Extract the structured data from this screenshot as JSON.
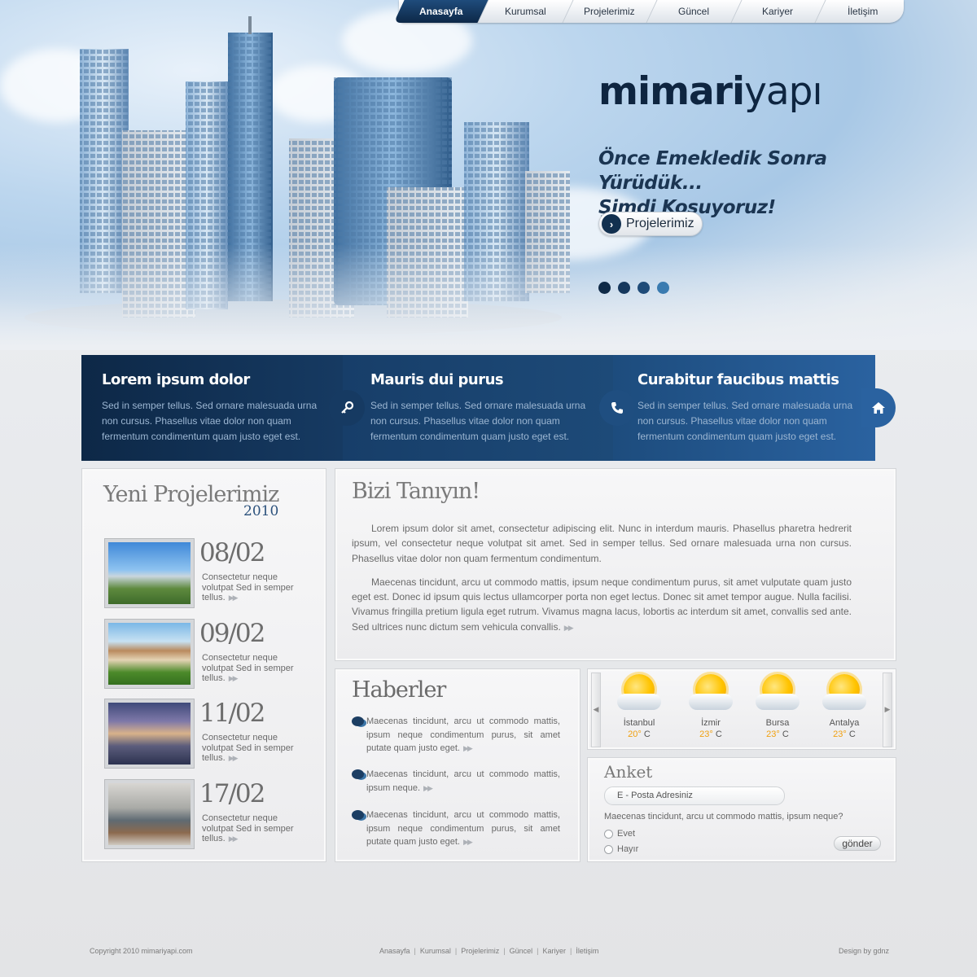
{
  "nav": {
    "items": [
      {
        "label": "Anasayfa",
        "active": true
      },
      {
        "label": "Kurumsal"
      },
      {
        "label": "Projelerimiz"
      },
      {
        "label": "Güncel"
      },
      {
        "label": "Kariyer"
      },
      {
        "label": "İletişim"
      }
    ]
  },
  "hero": {
    "logo_bold": "mimari",
    "logo_light": "yapı",
    "tagline_line1": "Önce Emekledik Sonra Yürüdük...",
    "tagline_line2": "Şimdi Koşuyoruz!",
    "button_label": "Projelerimiz",
    "slide_count": 4
  },
  "features": [
    {
      "title": "Lorem ipsum dolor",
      "text": "Sed in semper tellus. Sed ornare malesuada urna non cursus. Phasellus vitae dolor non quam fermentum condimentum quam justo eget est.",
      "icon": "key-icon"
    },
    {
      "title": "Mauris dui purus",
      "text": "Sed in semper tellus. Sed ornare malesuada urna non cursus. Phasellus vitae dolor non quam fermentum condimentum quam justo eget est.",
      "icon": "phone-icon"
    },
    {
      "title": "Curabitur faucibus mattis",
      "text": "Sed in semper tellus. Sed ornare malesuada urna non cursus. Phasellus vitae dolor non quam fermentum condimentum quam justo eget est.",
      "icon": "home-icon"
    }
  ],
  "projects": {
    "title": "Yeni Projelerimiz",
    "year": "2010",
    "items": [
      {
        "date": "08/02",
        "text": "Consectetur neque volutpat Sed in semper tellus."
      },
      {
        "date": "09/02",
        "text": "Consectetur neque volutpat Sed in semper tellus."
      },
      {
        "date": "11/02",
        "text": "Consectetur neque volutpat Sed in semper tellus."
      },
      {
        "date": "17/02",
        "text": "Consectetur neque volutpat Sed in semper tellus."
      }
    ]
  },
  "about": {
    "title": "Bizi Tanıyın!",
    "paragraph1": "Lorem ipsum dolor sit amet, consectetur adipiscing elit. Nunc in interdum mauris. Phasellus pharetra hedrerit ipsum, vel consectetur neque volutpat sit amet. Sed in semper tellus. Sed ornare malesuada urna non cursus. Phasellus vitae dolor non quam fermentum condimentum.",
    "paragraph2": "Maecenas tincidunt, arcu ut commodo mattis, ipsum neque condimentum purus, sit amet vulputate quam justo eget est. Donec id ipsum quis lectus ullamcorper porta non eget lectus. Donec sit amet tempor augue. Nulla facilisi. Vivamus fringilla pretium ligula eget rutrum. Vivamus magna lacus, lobortis ac interdum sit amet, convallis sed ante. Sed ultrices nunc dictum sem vehicula convallis."
  },
  "news": {
    "title": "Haberler",
    "items": [
      {
        "text": "Maecenas tincidunt, arcu ut commodo mattis, ipsum neque condimentum purus, sit amet putate quam justo eget."
      },
      {
        "text": "Maecenas tincidunt, arcu ut commodo mattis, ipsum neque."
      },
      {
        "text": "Maecenas tincidunt, arcu ut commodo mattis, ipsum neque condimentum purus, sit amet putate quam justo eget."
      }
    ]
  },
  "weather": {
    "cities": [
      {
        "name": "İstanbul",
        "temp": "20",
        "unit": "C",
        "icon": "sun-cloud-icon"
      },
      {
        "name": "İzmir",
        "temp": "23",
        "unit": "C",
        "icon": "sun-cloud-icon"
      },
      {
        "name": "Bursa",
        "temp": "23",
        "unit": "C",
        "icon": "sun-cloud-icon"
      },
      {
        "name": "Antalya",
        "temp": "23",
        "unit": "C",
        "icon": "sun-cloud-icon"
      }
    ],
    "degree_symbol": "°"
  },
  "poll": {
    "title": "Anket",
    "email_placeholder": "E - Posta Adresiniz",
    "question": "Maecenas tincidunt, arcu ut commodo mattis, ipsum neque?",
    "option_yes": "Evet",
    "option_no": "Hayır",
    "submit_label": "gönder"
  },
  "footer": {
    "copyright": "Copyright 2010 mimariyapi.com",
    "links": [
      "Anasayfa",
      "Kurumsal",
      "Projelerimiz",
      "Güncel",
      "Kariyer",
      "İletişim"
    ],
    "design": "Design by gdnz"
  },
  "colors": {
    "navy": "#0d2847",
    "accent_blue": "#2a62a0",
    "weather_temp": "#f0a010"
  }
}
